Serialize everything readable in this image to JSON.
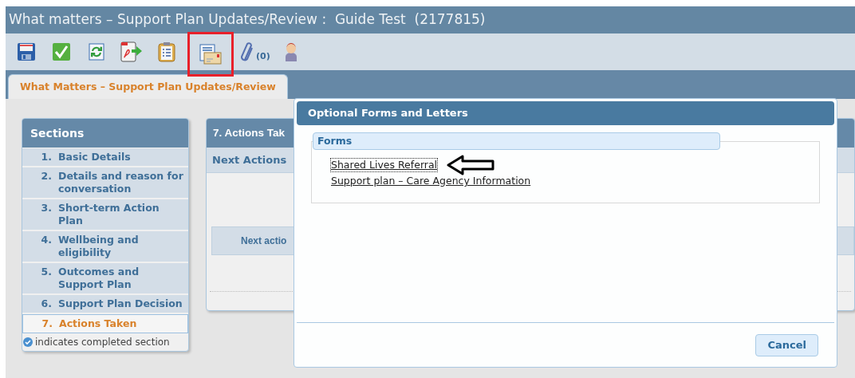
{
  "window": {
    "title": "What matters – Support Plan Updates/Review :  Guide Test  (2177815)"
  },
  "toolbar": [
    {
      "kind": "save",
      "highlighted": false
    },
    {
      "kind": "check",
      "highlighted": false
    },
    {
      "kind": "refresh",
      "highlighted": false
    },
    {
      "kind": "pdf",
      "highlighted": false
    },
    {
      "kind": "clipboard",
      "highlighted": false
    },
    {
      "kind": "letter",
      "highlighted": true
    },
    {
      "kind": "attachment",
      "count": "(0)",
      "highlighted": false
    },
    {
      "kind": "person",
      "highlighted": false
    }
  ],
  "tabs": [
    {
      "label": "What Matters – Support Plan Updates/Review",
      "selected": true
    }
  ],
  "sections": {
    "title": "Sections",
    "items": [
      {
        "number": "1.",
        "label": "Basic Details",
        "selected": false
      },
      {
        "number": "2.",
        "label": "Details and reason for conversation",
        "selected": false
      },
      {
        "number": "3.",
        "label": "Short-term Action Plan",
        "selected": false
      },
      {
        "number": "4.",
        "label": "Wellbeing and eligibility",
        "selected": false
      },
      {
        "number": "5.",
        "label": "Outcomes and Support Plan",
        "selected": false
      },
      {
        "number": "6.",
        "label": "Support Plan Decision",
        "selected": false
      },
      {
        "number": "7.",
        "label": "Actions Taken",
        "selected": true
      }
    ],
    "legend": "indicates completed section"
  },
  "panel": {
    "title": "7. Actions Tak",
    "subheading": "Next Actions",
    "row_label": "Next actio"
  },
  "dialog": {
    "title": "Optional Forms and Letters",
    "group": "Forms",
    "links": [
      {
        "label": "Shared Lives Referral",
        "focused": true,
        "pointed": true
      },
      {
        "label": "Support plan – Care Agency Information",
        "focused": false,
        "pointed": false
      }
    ],
    "buttons": [
      "Cancel"
    ]
  }
}
